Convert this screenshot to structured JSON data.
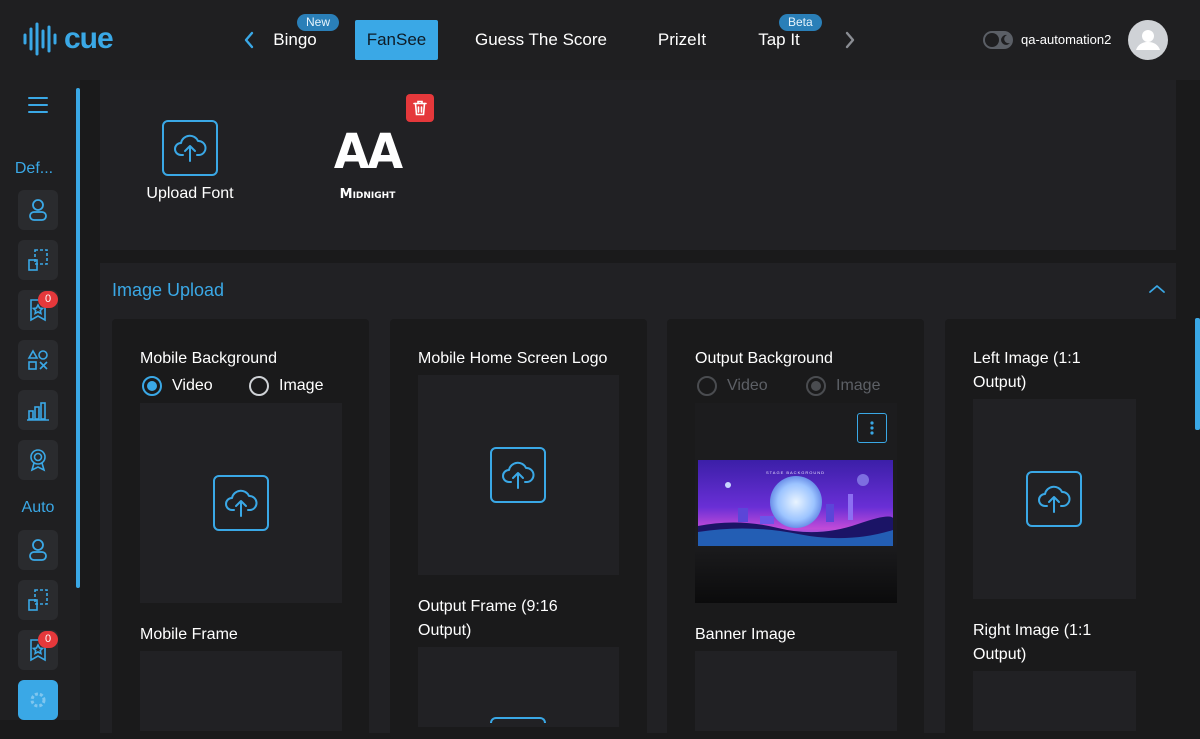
{
  "app": {
    "logo_text": "cue"
  },
  "nav": {
    "items": [
      {
        "label": "Bingo",
        "badge": "New"
      },
      {
        "label": "FanSee",
        "active": true
      },
      {
        "label": "Guess The Score"
      },
      {
        "label": "PrizeIt"
      },
      {
        "label": "Tap It",
        "badge": "Beta"
      }
    ]
  },
  "user": {
    "name": "qa-automation2"
  },
  "sidebar": {
    "group1_label": "Def...",
    "group2_label": "Auto",
    "counts": [
      "0",
      "0"
    ]
  },
  "fonts": {
    "upload_label": "Upload Font",
    "sample_glyphs": "AA",
    "sample_name": "Midnight"
  },
  "image_upload": {
    "title": "Image Upload",
    "cards": [
      {
        "label": "Mobile Background",
        "radio": [
          "Video",
          "Image"
        ],
        "selected": "Video"
      },
      {
        "label": "Mobile Home Screen Logo"
      },
      {
        "label": "Output Background",
        "radio": [
          "Video",
          "Image"
        ],
        "selected": "Image",
        "disabled": true,
        "thumbnail_caption": "STAGE BACKGROUND"
      },
      {
        "label_line1": "Left Image (1:1",
        "label_line2": "Output)"
      }
    ],
    "second_row": [
      {
        "label": "Mobile Frame"
      },
      {
        "label_line1": "Output Frame (9:16",
        "label_line2": "Output)"
      },
      {
        "label": "Banner Image"
      },
      {
        "label_line1": "Right Image (1:1",
        "label_line2": "Output)"
      }
    ]
  },
  "colors": {
    "accent": "#3aa8e6",
    "danger": "#e5383b",
    "bg": "#1a1a1b",
    "panel": "#212124"
  }
}
